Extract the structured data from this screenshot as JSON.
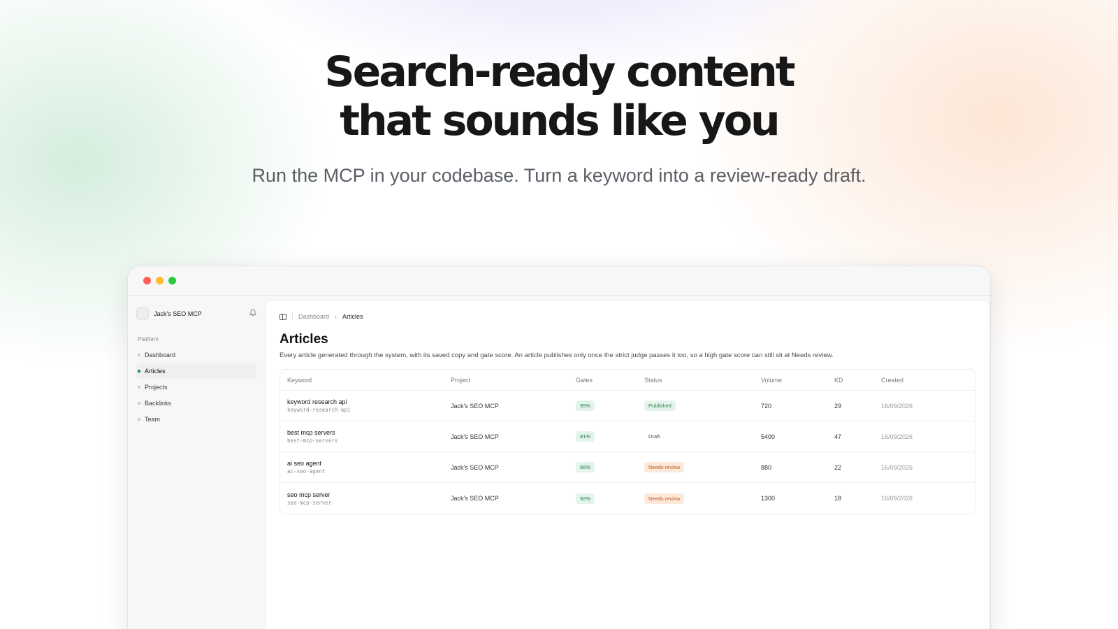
{
  "hero": {
    "title_line1": "Search-ready content",
    "title_line2": "that sounds like you",
    "subtitle": "Run the MCP in your codebase. Turn a keyword into a review-ready draft."
  },
  "app": {
    "workspace_name": "Jack's SEO MCP",
    "sidebar": {
      "section_label": "Platform",
      "items": [
        {
          "label": "Dashboard"
        },
        {
          "label": "Articles"
        },
        {
          "label": "Projects"
        },
        {
          "label": "Backlinks"
        },
        {
          "label": "Team"
        }
      ],
      "active_item": "Articles"
    },
    "breadcrumb": {
      "parent": "Dashboard",
      "separator": "›",
      "current": "Articles"
    },
    "page_title": "Articles",
    "page_description": "Every article generated through the system, with its saved copy and gate score. An article publishes only once the strict judge passes it too, so a high gate score can still sit at Needs review.",
    "table": {
      "columns": [
        "Keyword",
        "Project",
        "Gates",
        "Status",
        "Volume",
        "KD",
        "Created"
      ],
      "rows": [
        {
          "keyword": "keyword research api",
          "slug": "keyword-research-api",
          "project": "Jack's SEO MCP",
          "gates": "95%",
          "status": "Published",
          "volume": "720",
          "kd": "29",
          "created": "16/09/2026"
        },
        {
          "keyword": "best mcp servers",
          "slug": "best-mcp-servers",
          "project": "Jack's SEO MCP",
          "gates": "81%",
          "status": "Draft",
          "volume": "5400",
          "kd": "47",
          "created": "16/09/2026"
        },
        {
          "keyword": "ai seo agent",
          "slug": "ai-seo-agent",
          "project": "Jack's SEO MCP",
          "gates": "88%",
          "status": "Needs review",
          "volume": "880",
          "kd": "22",
          "created": "16/09/2026"
        },
        {
          "keyword": "seo mcp server",
          "slug": "seo-mcp-server",
          "project": "Jack's SEO MCP",
          "gates": "92%",
          "status": "Needs review",
          "volume": "1300",
          "kd": "18",
          "created": "16/09/2026"
        }
      ]
    }
  },
  "colors": {
    "accent_green": "#1f8f5a",
    "published_bg": "#e3f4ea",
    "review_bg": "#fde9da",
    "traffic_red": "#ff5f57",
    "traffic_yellow": "#febc2e",
    "traffic_green": "#28c840"
  },
  "icons": {
    "bell": "bell-icon",
    "sidebar_toggle": "sidebar-toggle-icon"
  }
}
